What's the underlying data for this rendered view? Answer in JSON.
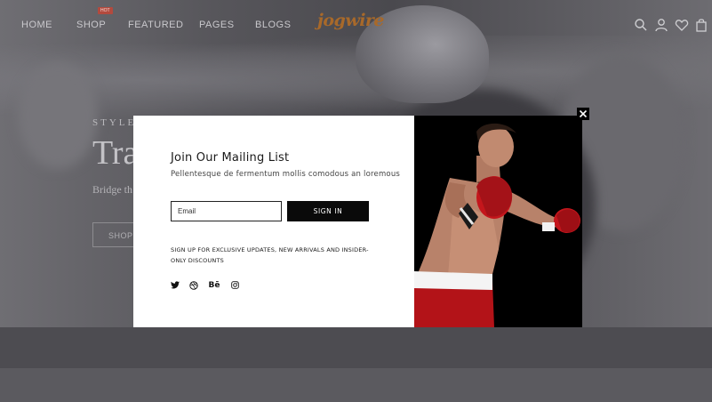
{
  "nav": {
    "items": [
      {
        "label": "HOME"
      },
      {
        "label": "SHOP",
        "badge": "HOT"
      },
      {
        "label": "FEATURED"
      },
      {
        "label": "PAGES"
      },
      {
        "label": "BLOGS"
      }
    ],
    "logo": "jogwire",
    "icons": [
      "search-icon",
      "user-icon",
      "heart-icon",
      "bag-icon"
    ]
  },
  "hero": {
    "eyebrow": "STYLE",
    "title": "Tra",
    "subtitle": "Bridge th",
    "button": "SHOP"
  },
  "modal": {
    "title": "Join Our Mailing List",
    "description": "Pellentesque de fermentum mollis comodous an loremous",
    "email_placeholder": "Email",
    "signin_label": "SIGN IN",
    "note": "SIGN UP FOR EXCLUSIVE UPDATES, NEW ARRIVALS AND INSIDER-ONLY DISCOUNTS",
    "social": [
      "twitter-icon",
      "dribbble-icon",
      "behance-icon",
      "instagram-icon"
    ],
    "behance_text": "Bē"
  },
  "colors": {
    "overlay": "#58575c",
    "modal_bg": "#ffffff",
    "button_bg": "#0a0a0a",
    "logo": "#a8692a",
    "hot_badge": "#b34a3e"
  }
}
